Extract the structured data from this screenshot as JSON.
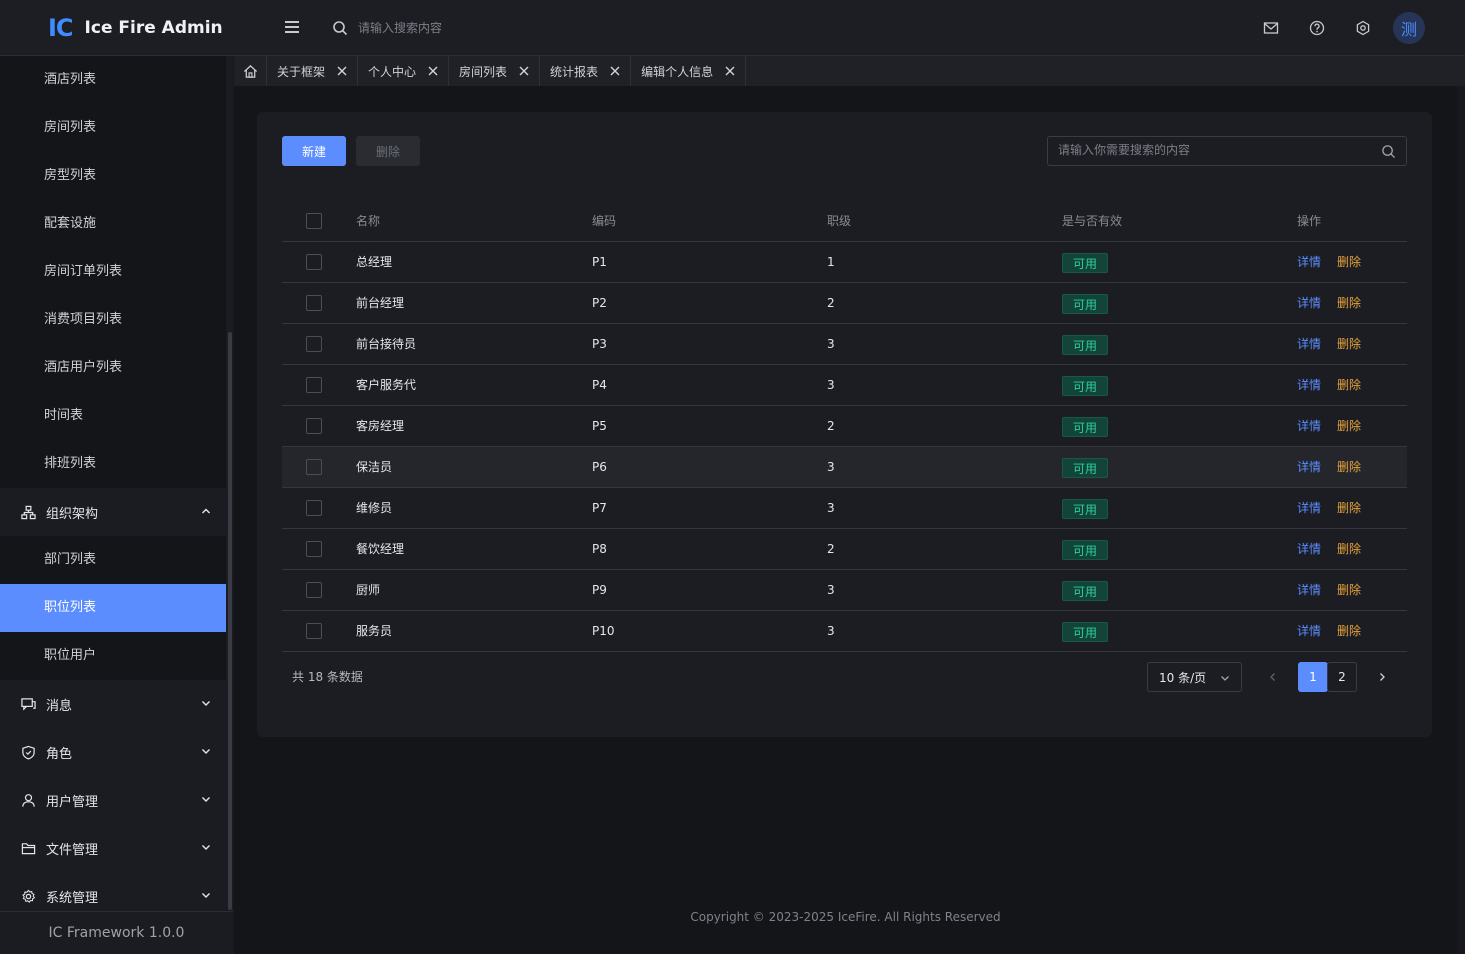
{
  "app": {
    "logo_mark": "IC",
    "title": "Ice Fire Admin",
    "search_placeholder": "请输入搜索内容",
    "avatar_text": "测"
  },
  "sidebar": {
    "sub_items_top": [
      {
        "label": "酒店列表"
      },
      {
        "label": "房间列表"
      },
      {
        "label": "房型列表"
      },
      {
        "label": "配套设施"
      },
      {
        "label": "房间订单列表"
      },
      {
        "label": "消费项目列表"
      },
      {
        "label": "酒店用户列表"
      },
      {
        "label": "时间表"
      },
      {
        "label": "排班列表"
      }
    ],
    "org_group": {
      "label": "组织架构",
      "icon": "org-icon",
      "expanded": true
    },
    "org_items": [
      {
        "label": "部门列表",
        "active": false
      },
      {
        "label": "职位列表",
        "active": true
      },
      {
        "label": "职位用户",
        "active": false
      }
    ],
    "groups": [
      {
        "label": "消息",
        "icon": "message-icon"
      },
      {
        "label": "角色",
        "icon": "shield-icon"
      },
      {
        "label": "用户管理",
        "icon": "user-icon"
      },
      {
        "label": "文件管理",
        "icon": "folder-icon"
      },
      {
        "label": "系统管理",
        "icon": "gear-icon"
      }
    ],
    "footer": "IC Framework 1.0.0"
  },
  "tabs": [
    {
      "label": "关于框架"
    },
    {
      "label": "个人中心"
    },
    {
      "label": "房间列表"
    },
    {
      "label": "统计报表"
    },
    {
      "label": "编辑个人信息"
    }
  ],
  "toolbar": {
    "new_label": "新建",
    "delete_label": "删除",
    "search_placeholder": "请输入你需要搜索的内容"
  },
  "table": {
    "headers": {
      "name": "名称",
      "code": "编码",
      "level": "职级",
      "valid": "是与否有效",
      "ops": "操作"
    },
    "rows": [
      {
        "name": "总经理",
        "code": "P1",
        "level": "1",
        "valid": "可用"
      },
      {
        "name": "前台经理",
        "code": "P2",
        "level": "2",
        "valid": "可用"
      },
      {
        "name": "前台接待员",
        "code": "P3",
        "level": "3",
        "valid": "可用"
      },
      {
        "name": "客户服务代",
        "code": "P4",
        "level": "3",
        "valid": "可用"
      },
      {
        "name": "客房经理",
        "code": "P5",
        "level": "2",
        "valid": "可用"
      },
      {
        "name": "保洁员",
        "code": "P6",
        "level": "3",
        "valid": "可用"
      },
      {
        "name": "维修员",
        "code": "P7",
        "level": "3",
        "valid": "可用"
      },
      {
        "name": "餐饮经理",
        "code": "P8",
        "level": "2",
        "valid": "可用"
      },
      {
        "name": "厨师",
        "code": "P9",
        "level": "3",
        "valid": "可用"
      },
      {
        "name": "服务员",
        "code": "P10",
        "level": "3",
        "valid": "可用"
      }
    ],
    "detail_label": "详情",
    "delete_label": "删除"
  },
  "pagination": {
    "total_text": "共 18 条数据",
    "page_size": "10 条/页",
    "pages": [
      "1",
      "2"
    ],
    "current": "1"
  },
  "footer": {
    "copyright": "Copyright © 2023-2025 IceFire. All Rights Reserved"
  },
  "colors": {
    "accent": "#5b8dff",
    "badge_text": "#2ecf97",
    "delete_link": "#e6a23c"
  }
}
